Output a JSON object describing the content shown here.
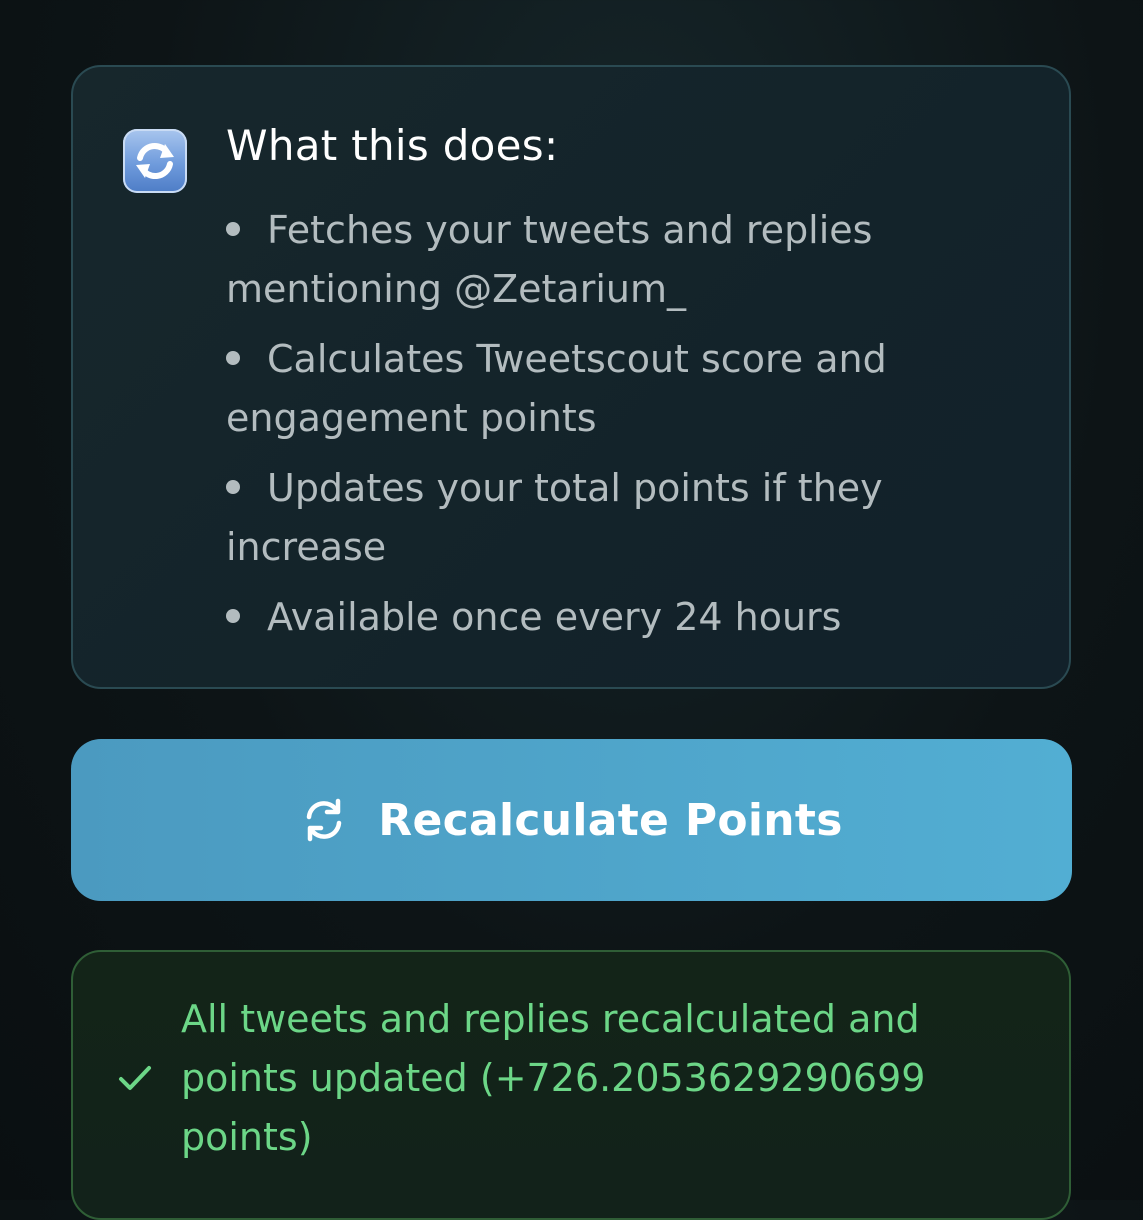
{
  "info": {
    "icon": "refresh-emoji-icon",
    "title": "What this does:",
    "items": [
      "Fetches your tweets and replies mentioning @Zetarium_",
      "Calculates Tweetscout score and engagement points",
      "Updates your total points if they increase",
      "Available once every 24 hours"
    ]
  },
  "button": {
    "icon": "refresh-icon",
    "label": "Recalculate Points"
  },
  "status": {
    "icon": "check-icon",
    "message": "All tweets and replies recalculated and points updated (+726.2053629290699 points)"
  },
  "colors": {
    "button_start": "#4b9ac0",
    "button_end": "#52aed3",
    "success_text": "#6cd687",
    "success_border": "#2f5e36",
    "info_border": "#2a4a52"
  }
}
